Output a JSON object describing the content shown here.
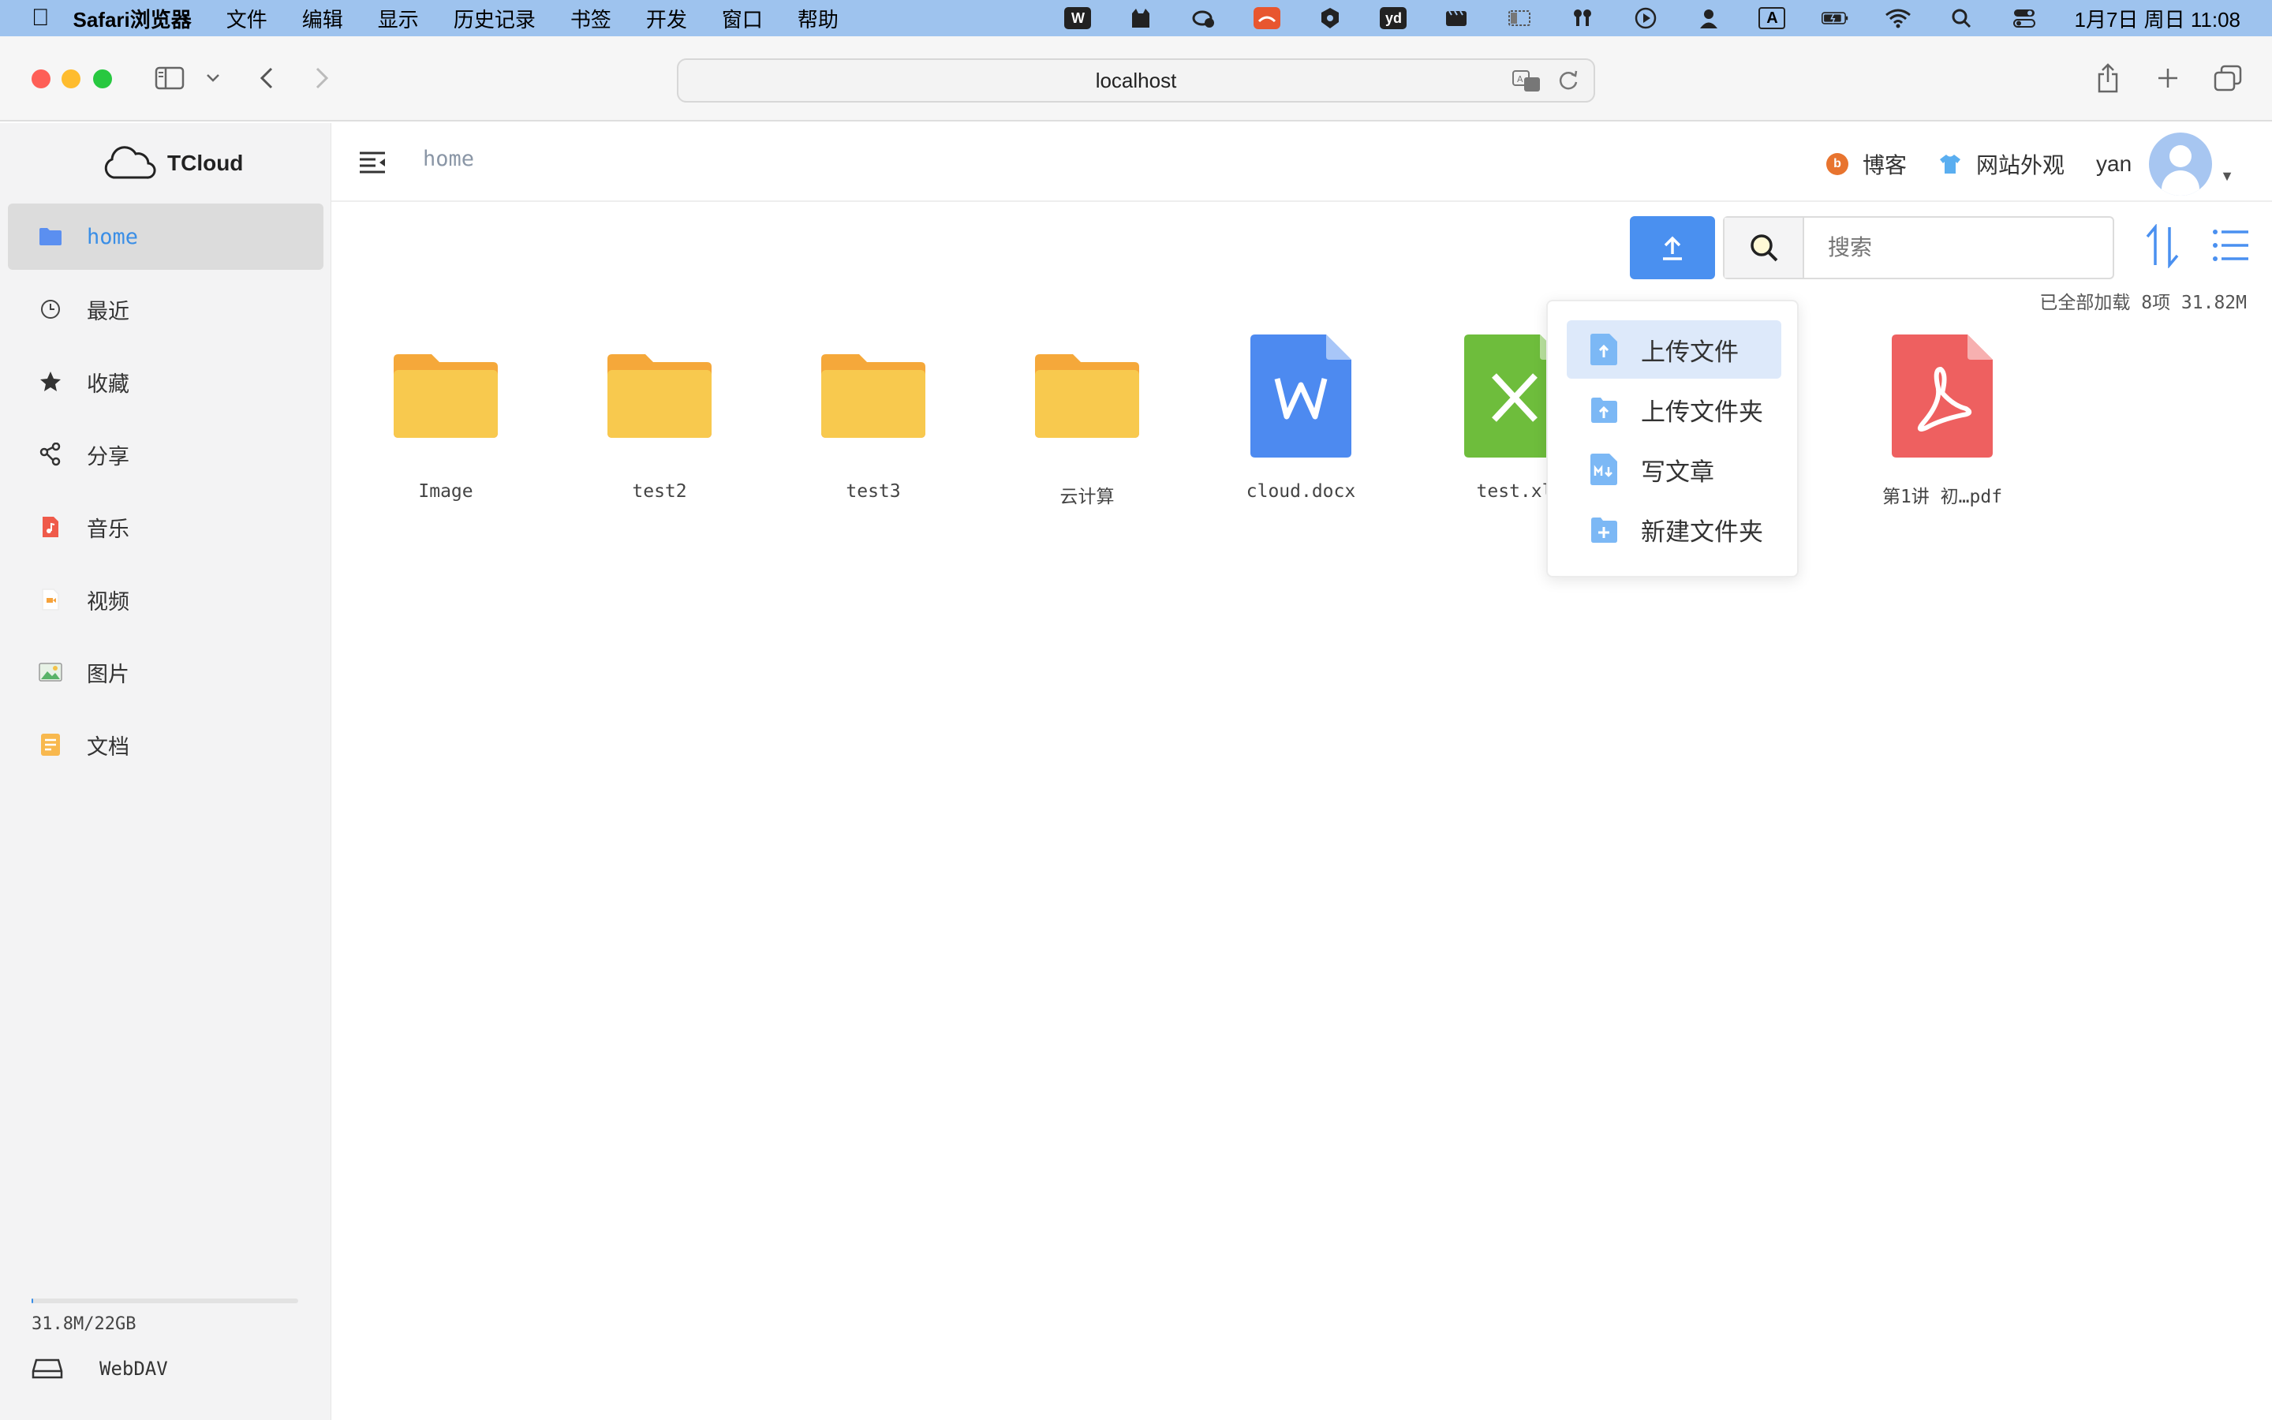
{
  "menubar": {
    "app_name": "Safari浏览器",
    "items": [
      "文件",
      "编辑",
      "显示",
      "历史记录",
      "书签",
      "开发",
      "窗口",
      "帮助"
    ],
    "status_badges": [
      "W",
      "yd",
      "A"
    ],
    "clock": "1月7日 周日 11:08"
  },
  "browser": {
    "url": "localhost"
  },
  "sidebar": {
    "brand": "TCloud",
    "items": [
      {
        "label": "home",
        "icon": "folder-icon",
        "active": true
      },
      {
        "label": "最近",
        "icon": "clock-icon"
      },
      {
        "label": "收藏",
        "icon": "star-icon"
      },
      {
        "label": "分享",
        "icon": "share-icon"
      },
      {
        "label": "音乐",
        "icon": "music-icon"
      },
      {
        "label": "视频",
        "icon": "video-icon"
      },
      {
        "label": "图片",
        "icon": "image-icon"
      },
      {
        "label": "文档",
        "icon": "document-icon"
      }
    ],
    "storage": {
      "text": "31.8M/22GB",
      "used_fraction": 0.0014
    },
    "webdav_label": "WebDAV"
  },
  "header": {
    "breadcrumb": "home",
    "blog_label": "博客",
    "appearance_label": "网站外观",
    "username": "yan"
  },
  "toolbar": {
    "search_placeholder": "搜索",
    "summary": "已全部加载 8项 31.82M"
  },
  "files": [
    {
      "name": "Image",
      "type": "folder"
    },
    {
      "name": "test2",
      "type": "folder"
    },
    {
      "name": "test3",
      "type": "folder"
    },
    {
      "name": "云计算",
      "type": "folder"
    },
    {
      "name": "cloud.docx",
      "type": "word"
    },
    {
      "name": "test.xl",
      "type": "excel"
    },
    {
      "name": "第1讲 初…pdf",
      "type": "pdf"
    }
  ],
  "upload_menu": {
    "items": [
      {
        "label": "上传文件",
        "icon": "upload-file-icon",
        "active": true
      },
      {
        "label": "上传文件夹",
        "icon": "upload-folder-icon"
      },
      {
        "label": "写文章",
        "icon": "markdown-icon"
      },
      {
        "label": "新建文件夹",
        "icon": "new-folder-icon"
      }
    ]
  },
  "colors": {
    "accent": "#4a90f0",
    "folder": "#f8c94e",
    "word": "#4d8af0",
    "excel": "#6ebd3c",
    "pdf": "#ee6060",
    "menubar": "#9ec3ee"
  }
}
